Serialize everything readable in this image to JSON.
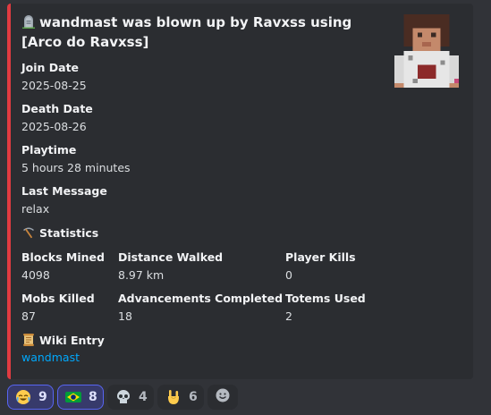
{
  "embed": {
    "accent_color": "#e03b41",
    "title": "wandmast was blown up by Ravxss using [Arco do Ravxss]",
    "title_icon": "headstone-icon",
    "thumbnail": "minecraft-player-avatar",
    "fields": {
      "join_date": {
        "name": "Join Date",
        "value": "2025-08-25"
      },
      "death_date": {
        "name": "Death Date",
        "value": "2025-08-26"
      },
      "playtime": {
        "name": "Playtime",
        "value": "5 hours 28 minutes"
      },
      "last_message": {
        "name": "Last Message",
        "value": "relax"
      }
    },
    "statistics": {
      "heading": "Statistics",
      "icon": "pickaxe-icon",
      "items": [
        {
          "name": "Blocks Mined",
          "value": "4098"
        },
        {
          "name": "Distance Walked",
          "value": "8.97 km"
        },
        {
          "name": "Player Kills",
          "value": "0"
        },
        {
          "name": "Mobs Killed",
          "value": "87"
        },
        {
          "name": "Advancements Completed",
          "value": "18"
        },
        {
          "name": "Totems Used",
          "value": "2"
        }
      ]
    },
    "wiki": {
      "heading": "Wiki Entry",
      "icon": "scroll-icon",
      "link_text": "wandmast"
    }
  },
  "reactions": [
    {
      "emoji": "tears-of-joy-emoji",
      "count": "9",
      "me": true
    },
    {
      "emoji": "brazil-flag-emoji",
      "count": "8",
      "me": true
    },
    {
      "emoji": "skull-emoji",
      "count": "4",
      "me": false
    },
    {
      "emoji": "rock-on-hand-emoji",
      "count": "6",
      "me": false
    }
  ],
  "add_reaction_icon": "add-reaction-icon"
}
